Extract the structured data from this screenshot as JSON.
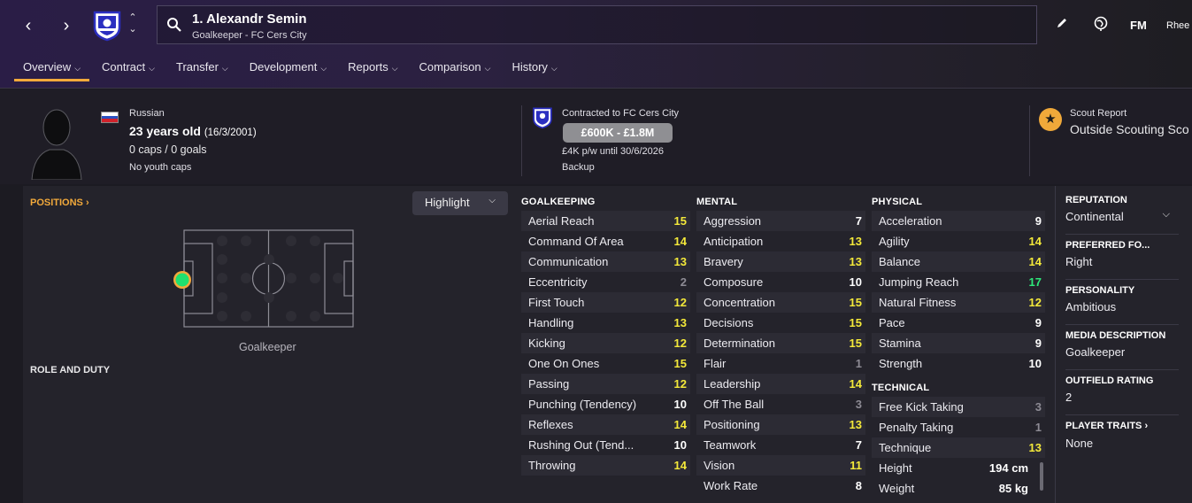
{
  "header": {
    "player_title": "1. Alexandr Semin",
    "player_subtitle": "Goalkeeper - FC Cers City",
    "fm_label": "FM",
    "user_label": "Rhee"
  },
  "tabs": [
    {
      "label": "Overview"
    },
    {
      "label": "Contract"
    },
    {
      "label": "Transfer"
    },
    {
      "label": "Development"
    },
    {
      "label": "Reports"
    },
    {
      "label": "Comparison"
    },
    {
      "label": "History"
    }
  ],
  "profile": {
    "nationality": "Russian",
    "age": "23 years old",
    "dob": "(16/3/2001)",
    "caps": "0 caps / 0 goals",
    "youth_caps": "No youth caps"
  },
  "contract": {
    "contracted_to": "Contracted to FC Cers City",
    "value": "£600K - £1.8M",
    "wage": "£4K p/w until 30/6/2026",
    "status": "Backup"
  },
  "scout": {
    "label": "Scout Report",
    "value": "Outside Scouting Sco"
  },
  "positions": {
    "title": "POSITIONS",
    "highlight_label": "Highlight",
    "caption": "Goalkeeper",
    "role_title": "ROLE AND DUTY"
  },
  "goalkeeping": {
    "title": "GOALKEEPING",
    "attrs": [
      {
        "name": "Aerial Reach",
        "value": "15"
      },
      {
        "name": "Command Of Area",
        "value": "14"
      },
      {
        "name": "Communication",
        "value": "13"
      },
      {
        "name": "Eccentricity",
        "value": "2"
      },
      {
        "name": "First Touch",
        "value": "12"
      },
      {
        "name": "Handling",
        "value": "13"
      },
      {
        "name": "Kicking",
        "value": "12"
      },
      {
        "name": "One On Ones",
        "value": "15"
      },
      {
        "name": "Passing",
        "value": "12"
      },
      {
        "name": "Punching (Tendency)",
        "value": "10"
      },
      {
        "name": "Reflexes",
        "value": "14"
      },
      {
        "name": "Rushing Out (Tend...",
        "value": "10"
      },
      {
        "name": "Throwing",
        "value": "14"
      }
    ]
  },
  "mental": {
    "title": "MENTAL",
    "attrs": [
      {
        "name": "Aggression",
        "value": "7"
      },
      {
        "name": "Anticipation",
        "value": "13"
      },
      {
        "name": "Bravery",
        "value": "13"
      },
      {
        "name": "Composure",
        "value": "10"
      },
      {
        "name": "Concentration",
        "value": "15"
      },
      {
        "name": "Decisions",
        "value": "15"
      },
      {
        "name": "Determination",
        "value": "15"
      },
      {
        "name": "Flair",
        "value": "1"
      },
      {
        "name": "Leadership",
        "value": "14"
      },
      {
        "name": "Off The Ball",
        "value": "3"
      },
      {
        "name": "Positioning",
        "value": "13"
      },
      {
        "name": "Teamwork",
        "value": "7"
      },
      {
        "name": "Vision",
        "value": "11"
      },
      {
        "name": "Work Rate",
        "value": "8"
      }
    ]
  },
  "physical": {
    "title": "PHYSICAL",
    "attrs": [
      {
        "name": "Acceleration",
        "value": "9"
      },
      {
        "name": "Agility",
        "value": "14"
      },
      {
        "name": "Balance",
        "value": "14"
      },
      {
        "name": "Jumping Reach",
        "value": "17"
      },
      {
        "name": "Natural Fitness",
        "value": "12"
      },
      {
        "name": "Pace",
        "value": "9"
      },
      {
        "name": "Stamina",
        "value": "9"
      },
      {
        "name": "Strength",
        "value": "10"
      }
    ]
  },
  "technical": {
    "title": "TECHNICAL",
    "attrs": [
      {
        "name": "Free Kick Taking",
        "value": "3"
      },
      {
        "name": "Penalty Taking",
        "value": "1"
      },
      {
        "name": "Technique",
        "value": "13"
      }
    ]
  },
  "body": {
    "height_label": "Height",
    "height_value": "194 cm",
    "weight_label": "Weight",
    "weight_value": "85 kg"
  },
  "side": {
    "reputation_label": "REPUTATION",
    "reputation_value": "Continental",
    "foot_label": "PREFERRED FO...",
    "foot_value": "Right",
    "personality_label": "PERSONALITY",
    "personality_value": "Ambitious",
    "media_label": "MEDIA DESCRIPTION",
    "media_value": "Goalkeeper",
    "outfield_label": "OUTFIELD RATING",
    "outfield_value": "2",
    "traits_label": "PLAYER TRAITS",
    "traits_value": "None"
  },
  "colors": {
    "accent": "#f2a93b",
    "value_high": "#f4e93a",
    "value_top": "#2ee87a",
    "value_low": "#8d8b94",
    "value_mid": "#ffffff"
  }
}
